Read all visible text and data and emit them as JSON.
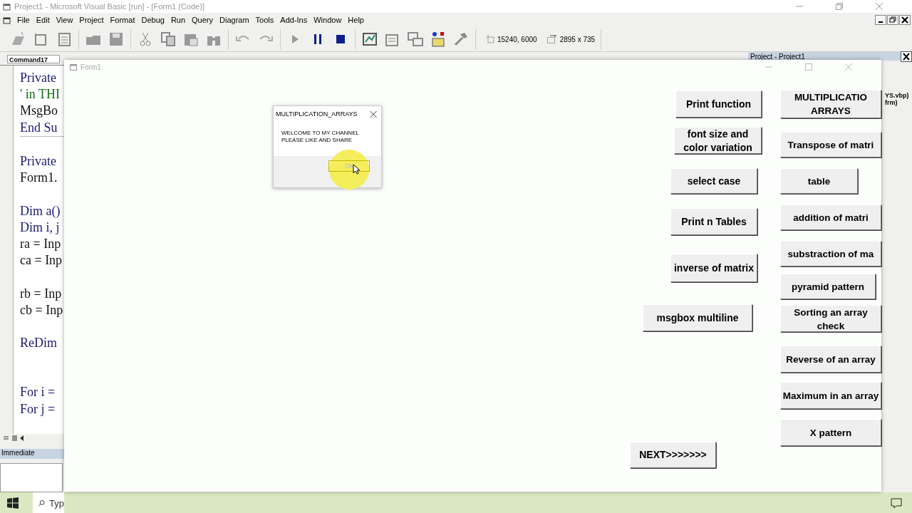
{
  "window": {
    "title": "Project1 - Microsoft Visual Basic [run] - [Form1 (Code)]",
    "menu": [
      "File",
      "Edit",
      "View",
      "Project",
      "Format",
      "Debug",
      "Run",
      "Query",
      "Diagram",
      "Tools",
      "Add-Ins",
      "Window",
      "Help"
    ]
  },
  "toolbar": {
    "run_controls": [
      {
        "kind": "play",
        "disabled": true
      },
      {
        "kind": "pause",
        "disabled": false
      },
      {
        "kind": "stop",
        "disabled": false
      }
    ],
    "position": "15240, 6000",
    "size": "2895 x 735"
  },
  "code_window": {
    "object_combo": "Command17",
    "blocks": [
      [
        {
          "text": "Private",
          "kind": "keyword"
        },
        {
          "text": "' in THI",
          "kind": "comment"
        },
        {
          "text": "MsgBo",
          "kind": "plain"
        },
        {
          "text": "End Su",
          "kind": "keyword"
        }
      ],
      [
        {
          "text": "Private",
          "kind": "keyword"
        },
        {
          "text": "Form1.",
          "kind": "plain"
        }
      ],
      [
        {
          "text": "Dim a()",
          "kind": "keyword"
        },
        {
          "text": "Dim i, j",
          "kind": "keyword"
        },
        {
          "text": "ra = Inp",
          "kind": "plain"
        },
        {
          "text": "ca = Inp",
          "kind": "plain"
        }
      ],
      [
        {
          "text": "rb = Inp",
          "kind": "plain"
        },
        {
          "text": "cb = Inp",
          "kind": "plain"
        }
      ],
      [
        {
          "text": "ReDim",
          "kind": "keyword"
        }
      ],
      [
        {
          "text": "For i =",
          "kind": "keyword"
        },
        {
          "text": "For j =",
          "kind": "keyword"
        }
      ]
    ]
  },
  "project_panel": {
    "title": "Project - Project1",
    "items": [
      "YS.vbp)",
      "frm)"
    ]
  },
  "immediate": {
    "title": "Immediate"
  },
  "form": {
    "title": "Form1",
    "buttons": [
      "Print function",
      "font size and color variation",
      "select case",
      "Print  n Tables",
      "inverse of matrix",
      "msgbox multiline",
      "NEXT>>>>>>>",
      "MULTIPLICATIO ARRAYS",
      "Transpose of matri",
      "table",
      "addition of matri",
      "substraction of ma",
      "pyramid pattern",
      "Sorting an array check",
      "Reverse of an array",
      "Maximum in an array",
      "X pattern"
    ]
  },
  "message_box": {
    "title": "MULTIPLICATION_ARRAYS",
    "lines": [
      "WELCOME TO MY CHANNEL",
      "PLEASE LIKE AND SHARE"
    ],
    "button": "OK"
  },
  "taskbar": {
    "search": "Typ"
  }
}
